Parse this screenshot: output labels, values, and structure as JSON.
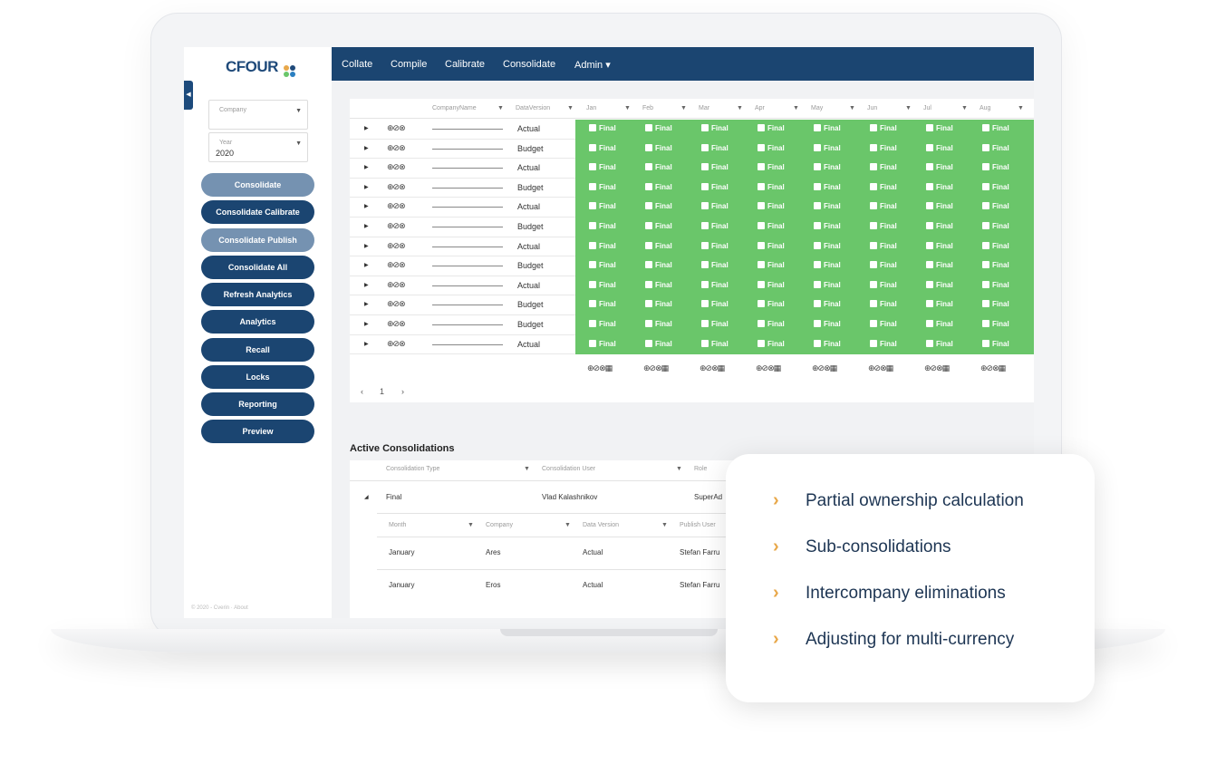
{
  "app": {
    "logo_text": "CFOUR",
    "logo_colors": [
      "#e8a84a",
      "#1f4a7a",
      "#6ac66a",
      "#2a7fc1"
    ]
  },
  "nav": {
    "items": [
      "Collate",
      "Compile",
      "Calibrate",
      "Consolidate",
      "Admin ▾"
    ]
  },
  "filters": {
    "company_label": "Company",
    "company_value": "",
    "year_label": "Year",
    "year_value": "2020"
  },
  "sidebar": {
    "buttons": [
      "Consolidate",
      "Consolidate Calibrate",
      "Consolidate Publish",
      "Consolidate All",
      "Refresh Analytics",
      "Analytics",
      "Recall",
      "Locks",
      "Reporting",
      "Preview"
    ]
  },
  "grid": {
    "headers": [
      "CompanyName",
      "DataVersion",
      "Jan",
      "Feb",
      "Mar",
      "Apr",
      "May",
      "Jun",
      "Jul",
      "Aug"
    ],
    "rows": [
      "Actual",
      "Budget",
      "Actual",
      "Budget",
      "Actual",
      "Budget",
      "Actual",
      "Budget",
      "Actual",
      "Budget",
      "Budget",
      "Actual"
    ],
    "cell_label": "Final",
    "action_icons": "⊕⊘⊗",
    "footer_icons": "⊕⊘⊗▦",
    "page": "1",
    "cell_color": "#6ac66a"
  },
  "active": {
    "title": "Active Consolidations",
    "headers": [
      "Consolidation Type",
      "Consolidation User",
      "Role"
    ],
    "row": {
      "type": "Final",
      "user": "Vlad Kalashnikov",
      "role": "SuperAd"
    },
    "sub_headers": [
      "Month",
      "Company",
      "Data Version",
      "Publish User"
    ],
    "sub_rows": [
      {
        "month": "January",
        "company": "Ares",
        "version": "Actual",
        "user": "Stefan Farru"
      },
      {
        "month": "January",
        "company": "Eros",
        "version": "Actual",
        "user": "Stefan Farru"
      }
    ]
  },
  "footer": {
    "text": "© 2020 - Cverin  ·  About"
  },
  "features": [
    "Partial ownership calculation",
    "Sub-consolidations",
    "Intercompany eliminations",
    "Adjusting for multi-currency"
  ],
  "accent_color": "#1b4571",
  "chevron_color": "#e8a84a"
}
